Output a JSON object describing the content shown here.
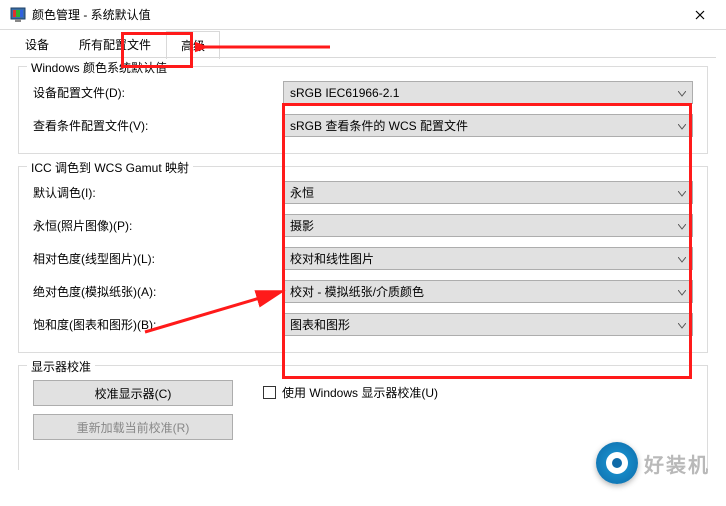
{
  "title": "颜色管理 - 系统默认值",
  "tabs": {
    "devices": "设备",
    "profiles": "所有配置文件",
    "advanced": "高级"
  },
  "section1": {
    "legend": "Windows 颜色系统默认值",
    "deviceProfileLabel": "设备配置文件(D):",
    "deviceProfileValue": "sRGB IEC61966-2.1",
    "viewCondLabel": "查看条件配置文件(V):",
    "viewCondValue": "sRGB 查看条件的 WCS 配置文件"
  },
  "section2": {
    "legend": "ICC 调色到 WCS Gamut 映射",
    "defaultLabel": "默认调色(I):",
    "defaultValue": "永恒",
    "permPhotoLabel": "永恒(照片图像)(P):",
    "permPhotoValue": "摄影",
    "relColLabel": "相对色度(线型图片)(L):",
    "relColValue": "校对和线性图片",
    "absColLabel": "绝对色度(模拟纸张)(A):",
    "absColValue": "校对 - 模拟纸张/介质颜色",
    "satLabel": "饱和度(图表和图形)(B):",
    "satValue": "图表和图形"
  },
  "section3": {
    "legend": "显示器校准",
    "calibBtn": "校准显示器(C)",
    "reloadBtn": "重新加载当前校准(R)",
    "useCalib": "使用 Windows 显示器校准(U)"
  },
  "watermark": "好装机"
}
